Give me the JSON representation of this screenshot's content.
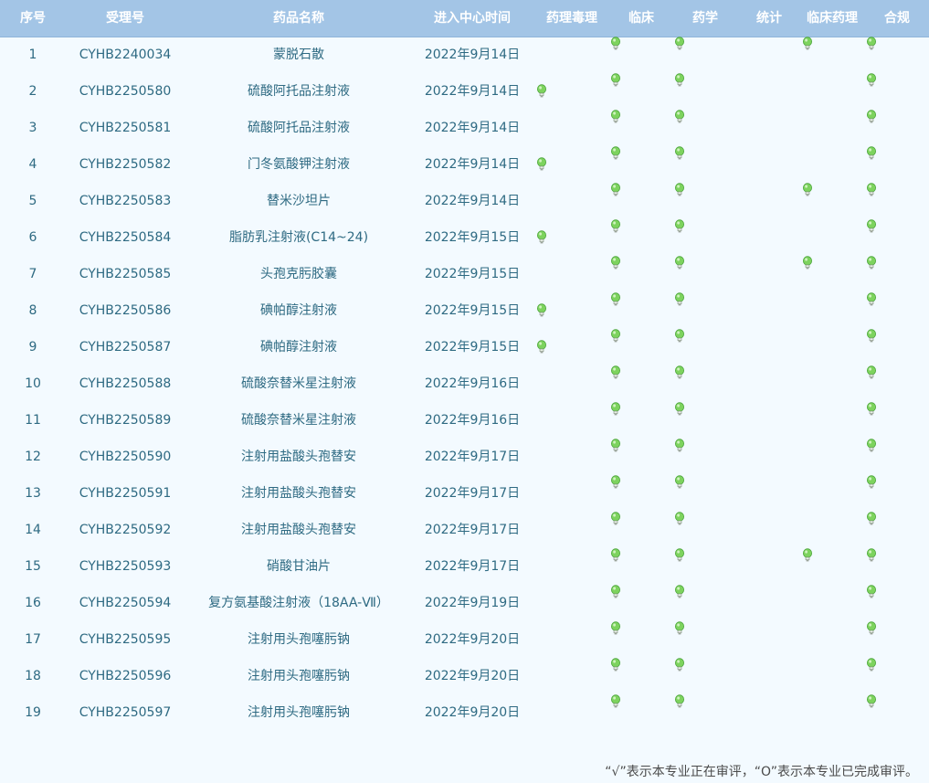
{
  "headers": {
    "seq": "序号",
    "acceptance_no": "受理号",
    "drug_name": "药品名称",
    "entry_time": "进入中心时间",
    "pharm_tox": "药理毒理",
    "clinical": "临床",
    "pharmacy": "药学",
    "statistics": "统计",
    "clin_pharm": "临床药理",
    "compliance": "合规"
  },
  "status_icon": "lightbulb-icon",
  "bulb_color": "#7dd35e",
  "rows": [
    {
      "seq": "1",
      "no": "CYHB2240034",
      "name": "蒙脱石散",
      "date": "2022年9月14日",
      "tox": false,
      "clin": true,
      "pharm": true,
      "stat": false,
      "cp": true,
      "comp": true
    },
    {
      "seq": "2",
      "no": "CYHB2250580",
      "name": "硫酸阿托品注射液",
      "date": "2022年9月14日",
      "tox": true,
      "clin": true,
      "pharm": true,
      "stat": false,
      "cp": false,
      "comp": true
    },
    {
      "seq": "3",
      "no": "CYHB2250581",
      "name": "硫酸阿托品注射液",
      "date": "2022年9月14日",
      "tox": false,
      "clin": true,
      "pharm": true,
      "stat": false,
      "cp": false,
      "comp": true
    },
    {
      "seq": "4",
      "no": "CYHB2250582",
      "name": "门冬氨酸钾注射液",
      "date": "2022年9月14日",
      "tox": true,
      "clin": true,
      "pharm": true,
      "stat": false,
      "cp": false,
      "comp": true
    },
    {
      "seq": "5",
      "no": "CYHB2250583",
      "name": "替米沙坦片",
      "date": "2022年9月14日",
      "tox": false,
      "clin": true,
      "pharm": true,
      "stat": false,
      "cp": true,
      "comp": true
    },
    {
      "seq": "6",
      "no": "CYHB2250584",
      "name": "脂肪乳注射液(C14~24)",
      "date": "2022年9月15日",
      "tox": true,
      "clin": true,
      "pharm": true,
      "stat": false,
      "cp": false,
      "comp": true
    },
    {
      "seq": "7",
      "no": "CYHB2250585",
      "name": "头孢克肟胶囊",
      "date": "2022年9月15日",
      "tox": false,
      "clin": true,
      "pharm": true,
      "stat": false,
      "cp": true,
      "comp": true
    },
    {
      "seq": "8",
      "no": "CYHB2250586",
      "name": "碘帕醇注射液",
      "date": "2022年9月15日",
      "tox": true,
      "clin": true,
      "pharm": true,
      "stat": false,
      "cp": false,
      "comp": true
    },
    {
      "seq": "9",
      "no": "CYHB2250587",
      "name": "碘帕醇注射液",
      "date": "2022年9月15日",
      "tox": true,
      "clin": true,
      "pharm": true,
      "stat": false,
      "cp": false,
      "comp": true
    },
    {
      "seq": "10",
      "no": "CYHB2250588",
      "name": "硫酸奈替米星注射液",
      "date": "2022年9月16日",
      "tox": false,
      "clin": true,
      "pharm": true,
      "stat": false,
      "cp": false,
      "comp": true
    },
    {
      "seq": "11",
      "no": "CYHB2250589",
      "name": "硫酸奈替米星注射液",
      "date": "2022年9月16日",
      "tox": false,
      "clin": true,
      "pharm": true,
      "stat": false,
      "cp": false,
      "comp": true
    },
    {
      "seq": "12",
      "no": "CYHB2250590",
      "name": "注射用盐酸头孢替安",
      "date": "2022年9月17日",
      "tox": false,
      "clin": true,
      "pharm": true,
      "stat": false,
      "cp": false,
      "comp": true
    },
    {
      "seq": "13",
      "no": "CYHB2250591",
      "name": "注射用盐酸头孢替安",
      "date": "2022年9月17日",
      "tox": false,
      "clin": true,
      "pharm": true,
      "stat": false,
      "cp": false,
      "comp": true
    },
    {
      "seq": "14",
      "no": "CYHB2250592",
      "name": "注射用盐酸头孢替安",
      "date": "2022年9月17日",
      "tox": false,
      "clin": true,
      "pharm": true,
      "stat": false,
      "cp": false,
      "comp": true
    },
    {
      "seq": "15",
      "no": "CYHB2250593",
      "name": "硝酸甘油片",
      "date": "2022年9月17日",
      "tox": false,
      "clin": true,
      "pharm": true,
      "stat": false,
      "cp": true,
      "comp": true
    },
    {
      "seq": "16",
      "no": "CYHB2250594",
      "name": "复方氨基酸注射液（18AA-Ⅶ）",
      "date": "2022年9月19日",
      "tox": false,
      "clin": true,
      "pharm": true,
      "stat": false,
      "cp": false,
      "comp": true
    },
    {
      "seq": "17",
      "no": "CYHB2250595",
      "name": "注射用头孢噻肟钠",
      "date": "2022年9月20日",
      "tox": false,
      "clin": true,
      "pharm": true,
      "stat": false,
      "cp": false,
      "comp": true
    },
    {
      "seq": "18",
      "no": "CYHB2250596",
      "name": "注射用头孢噻肟钠",
      "date": "2022年9月20日",
      "tox": false,
      "clin": true,
      "pharm": true,
      "stat": false,
      "cp": false,
      "comp": true
    },
    {
      "seq": "19",
      "no": "CYHB2250597",
      "name": "注射用头孢噻肟钠",
      "date": "2022年9月20日",
      "tox": false,
      "clin": true,
      "pharm": true,
      "stat": false,
      "cp": false,
      "comp": true
    }
  ],
  "footer_note": "“√”表示本专业正在审评，“O”表示本专业已完成审评。"
}
